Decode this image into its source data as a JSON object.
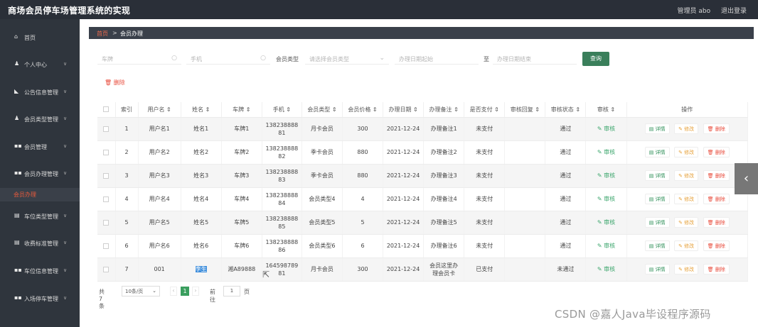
{
  "header": {
    "title": "商场会员停车场管理系统的实现",
    "user": "管理员 abo",
    "logout": "退出登录"
  },
  "sidebar": {
    "items": [
      {
        "icon": "home-icon",
        "label": "首页",
        "chevron": ""
      },
      {
        "icon": "user-icon",
        "label": "个人中心",
        "chevron": "∨"
      },
      {
        "icon": "megaphone-icon",
        "label": "公告信息管理",
        "chevron": "∨"
      },
      {
        "icon": "user-icon",
        "label": "会员类型管理",
        "chevron": "∨"
      },
      {
        "icon": "grid-icon",
        "label": "会员管理",
        "chevron": "∨"
      },
      {
        "icon": "grid-icon",
        "label": "会员办理管理",
        "chevron": "∨"
      },
      {
        "icon": "doc-icon",
        "label": "车位类型管理",
        "chevron": "∨"
      },
      {
        "icon": "doc-icon",
        "label": "收费标准管理",
        "chevron": "∨"
      },
      {
        "icon": "grid-icon",
        "label": "车位信息管理",
        "chevron": "∨"
      },
      {
        "icon": "grid-icon",
        "label": "入场停车管理",
        "chevron": "∨"
      }
    ],
    "active_sub": "会员办理"
  },
  "breadcrumb": {
    "home": "首页",
    "sep": ">",
    "current": "会员办理"
  },
  "search": {
    "plate_ph": "车牌",
    "phone_ph": "手机",
    "type_label": "会员类型",
    "type_ph": "请选择会员类型",
    "start_ph": "办理日期起始",
    "to_label": "至",
    "end_ph": "办理日期结束",
    "query_btn": "查询"
  },
  "toolbar": {
    "delete": "删除"
  },
  "table": {
    "headers": [
      "",
      "索引",
      "用户名 ⇕",
      "姓名 ⇕",
      "车牌 ⇕",
      "手机 ⇕",
      "会员类型 ⇕",
      "会员价格 ⇕",
      "办理日期 ⇕",
      "办理备注 ⇕",
      "是否支付 ⇕",
      "审核回复 ⇕",
      "审核状态 ⇕",
      "审核 ⇕",
      "操作"
    ],
    "rows": [
      {
        "idx": "1",
        "user": "用户名1",
        "name": "姓名1",
        "plate": "车牌1",
        "phone": "13823888881",
        "type": "月卡会员",
        "price": "300",
        "date": "2021-12-24",
        "note": "办理备注1",
        "paid": "未支付",
        "reply": "",
        "status": "通过"
      },
      {
        "idx": "2",
        "user": "用户名2",
        "name": "姓名2",
        "plate": "车牌2",
        "phone": "13823888882",
        "type": "季卡会员",
        "price": "880",
        "date": "2021-12-24",
        "note": "办理备注2",
        "paid": "未支付",
        "reply": "",
        "status": "通过"
      },
      {
        "idx": "3",
        "user": "用户名3",
        "name": "姓名3",
        "plate": "车牌3",
        "phone": "13823888883",
        "type": "季卡会员",
        "price": "880",
        "date": "2021-12-24",
        "note": "办理备注3",
        "paid": "未支付",
        "reply": "",
        "status": "通过"
      },
      {
        "idx": "4",
        "user": "用户名4",
        "name": "姓名4",
        "plate": "车牌4",
        "phone": "13823888884",
        "type": "会员类型4",
        "price": "4",
        "date": "2021-12-24",
        "note": "办理备注4",
        "paid": "未支付",
        "reply": "",
        "status": "通过"
      },
      {
        "idx": "5",
        "user": "用户名5",
        "name": "姓名5",
        "plate": "车牌5",
        "phone": "13823888885",
        "type": "会员类型5",
        "price": "5",
        "date": "2021-12-24",
        "note": "办理备注5",
        "paid": "未支付",
        "reply": "",
        "status": "通过"
      },
      {
        "idx": "6",
        "user": "用户名6",
        "name": "姓名6",
        "plate": "车牌6",
        "phone": "13823888886",
        "type": "会员类型6",
        "price": "6",
        "date": "2021-12-24",
        "note": "办理备注6",
        "paid": "未支付",
        "reply": "",
        "status": "通过"
      },
      {
        "idx": "7",
        "user": "001",
        "name": "李生",
        "plate": "湘A89888",
        "phone": "16459878981",
        "type": "月卡会员",
        "price": "300",
        "date": "2021-12-24",
        "note": "会员这里办理会员卡",
        "paid": "已支付",
        "reply": "",
        "status": "未通过"
      }
    ],
    "audit_label": "审核",
    "detail_label": "详情",
    "edit_label": "修改",
    "delete_label": "删除"
  },
  "pagination": {
    "total": "共 7 条",
    "size": "10条/页",
    "current": "1",
    "goto_prefix": "前往",
    "goto_value": "1",
    "goto_suffix": "页"
  },
  "side_tab": "‹",
  "watermark": "CSDN @嘉人Java毕设程序源码"
}
